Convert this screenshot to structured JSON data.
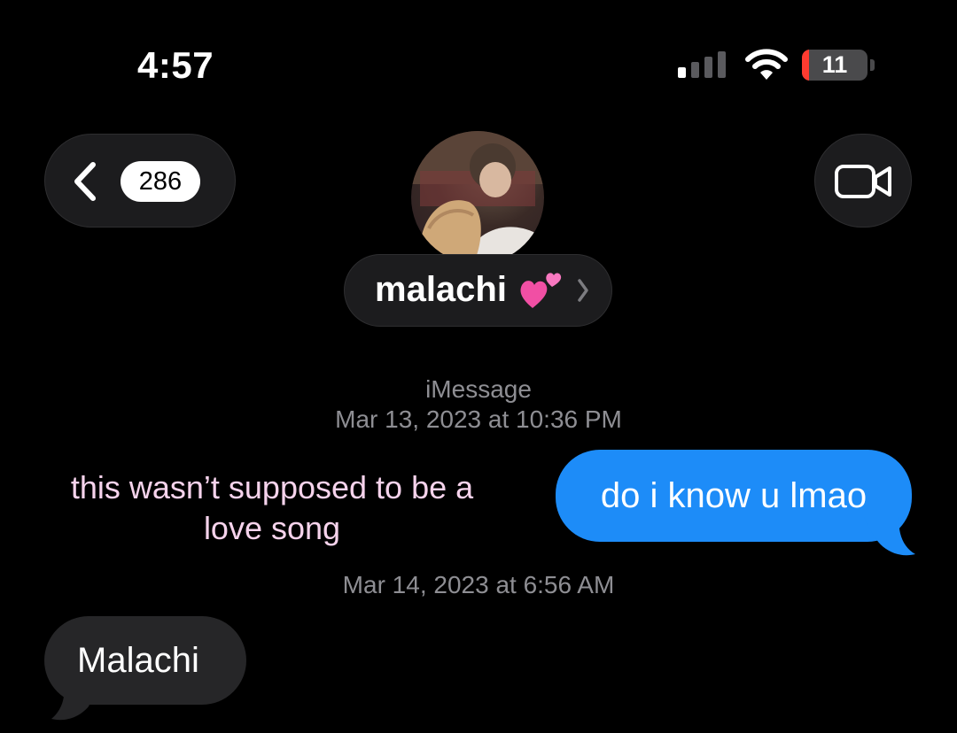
{
  "status_bar": {
    "time": "4:57",
    "battery_level": "11",
    "battery_fill_fraction": 0.11,
    "battery_fill_color": "#ff3b30",
    "signal_bars_active": 1,
    "signal_bars_total": 4
  },
  "nav": {
    "back_icon": "chevron-left-icon",
    "unread_count": "286",
    "video_icon": "video-camera-icon",
    "avatar": "contact-photo",
    "contact_name": "malachi",
    "contact_emoji": "💕",
    "detail_icon": "chevron-right-icon"
  },
  "thread": {
    "service": "iMessage",
    "timestamp_1": "Mar 13, 2023 at 10:36 PM",
    "messages": [
      {
        "direction": "sent",
        "text": "do i know u lmao"
      },
      {
        "direction": "received",
        "text": "Malachi"
      }
    ],
    "timestamp_2": "Mar 14, 2023 at 6:56 AM"
  },
  "overlay": {
    "caption_line_1": "this wasn’t supposed to be a",
    "caption_line_2": "love song"
  },
  "colors": {
    "background": "#000000",
    "sent_bubble": "#1d8cf8",
    "received_bubble": "#262628",
    "caption": "#f6d3ec",
    "secondary_text": "#8e8e93"
  }
}
